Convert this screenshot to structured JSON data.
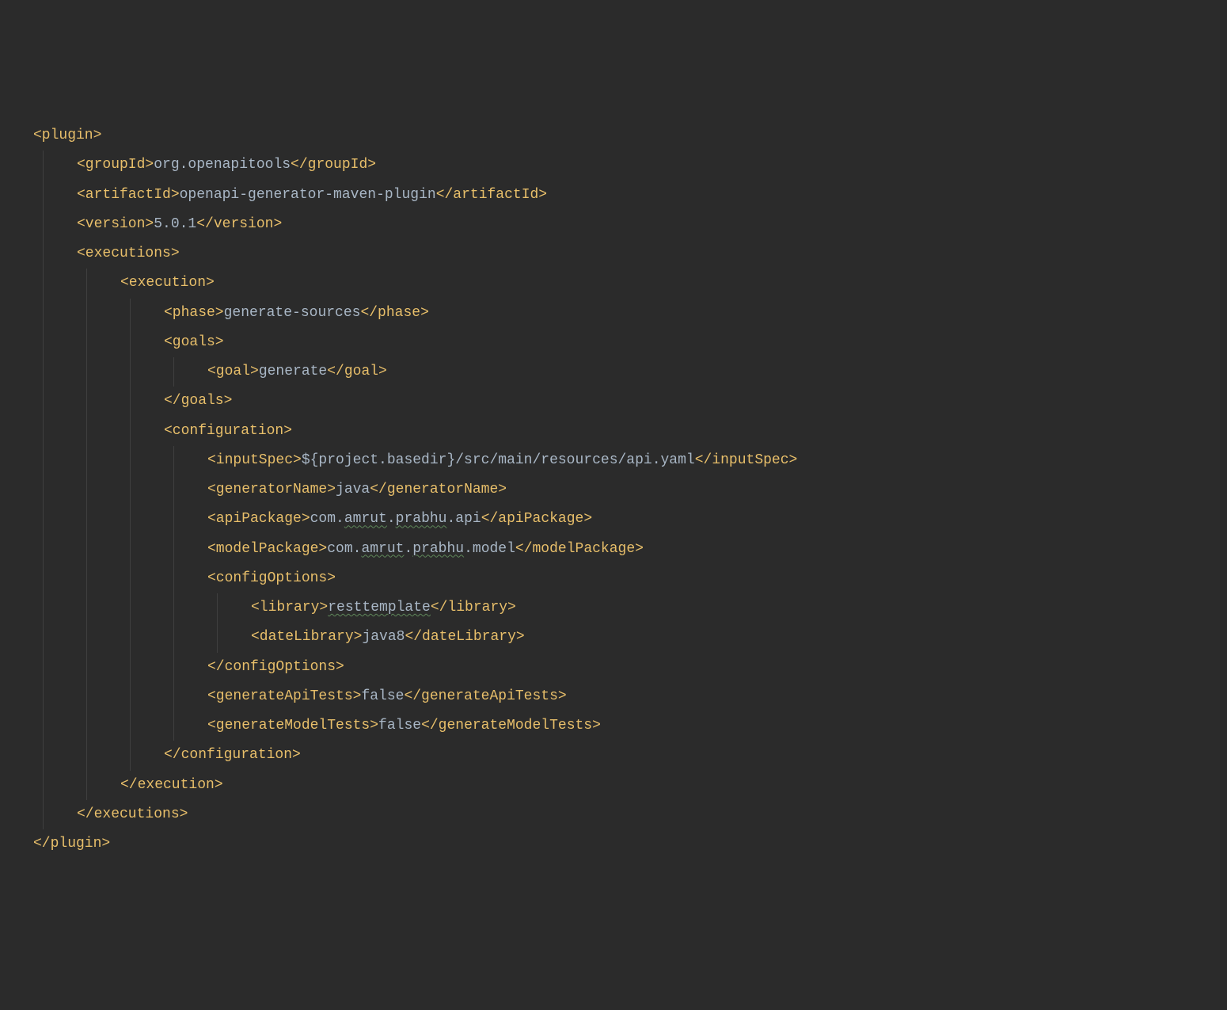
{
  "code": {
    "lines": [
      {
        "indent": 0,
        "guides": [],
        "segments": [
          {
            "type": "tag",
            "text": "<plugin>"
          }
        ]
      },
      {
        "indent": 1,
        "guides": [
          0
        ],
        "segments": [
          {
            "type": "tag",
            "text": "<groupId>"
          },
          {
            "type": "text",
            "text": "org.openapitools"
          },
          {
            "type": "tag",
            "text": "</groupId>"
          }
        ]
      },
      {
        "indent": 1,
        "guides": [
          0
        ],
        "segments": [
          {
            "type": "tag",
            "text": "<artifactId>"
          },
          {
            "type": "text",
            "text": "openapi-generator-maven-plugin"
          },
          {
            "type": "tag",
            "text": "</artifactId>"
          }
        ]
      },
      {
        "indent": 1,
        "guides": [
          0
        ],
        "segments": [
          {
            "type": "tag",
            "text": "<version>"
          },
          {
            "type": "text",
            "text": "5.0.1"
          },
          {
            "type": "tag",
            "text": "</version>"
          }
        ]
      },
      {
        "indent": 1,
        "guides": [
          0
        ],
        "segments": [
          {
            "type": "tag",
            "text": "<executions>"
          }
        ]
      },
      {
        "indent": 2,
        "guides": [
          0,
          1
        ],
        "segments": [
          {
            "type": "tag",
            "text": "<execution>"
          }
        ]
      },
      {
        "indent": 3,
        "guides": [
          0,
          1,
          2
        ],
        "segments": [
          {
            "type": "tag",
            "text": "<phase>"
          },
          {
            "type": "text",
            "text": "generate-sources"
          },
          {
            "type": "tag",
            "text": "</phase>"
          }
        ]
      },
      {
        "indent": 3,
        "guides": [
          0,
          1,
          2
        ],
        "segments": [
          {
            "type": "tag",
            "text": "<goals>"
          }
        ]
      },
      {
        "indent": 4,
        "guides": [
          0,
          1,
          2,
          3
        ],
        "segments": [
          {
            "type": "tag",
            "text": "<goal>"
          },
          {
            "type": "text",
            "text": "generate"
          },
          {
            "type": "tag",
            "text": "</goal>"
          }
        ]
      },
      {
        "indent": 3,
        "guides": [
          0,
          1,
          2
        ],
        "segments": [
          {
            "type": "tag",
            "text": "</goals>"
          }
        ]
      },
      {
        "indent": 3,
        "guides": [
          0,
          1,
          2
        ],
        "segments": [
          {
            "type": "tag",
            "text": "<configuration>"
          }
        ]
      },
      {
        "indent": 4,
        "guides": [
          0,
          1,
          2,
          3
        ],
        "segments": [
          {
            "type": "tag",
            "text": "<inputSpec>"
          },
          {
            "type": "text",
            "text": "${project.basedir}/src/main/resources/api.yaml"
          },
          {
            "type": "tag",
            "text": "</inputSpec>"
          }
        ]
      },
      {
        "indent": 4,
        "guides": [
          0,
          1,
          2,
          3
        ],
        "segments": [
          {
            "type": "tag",
            "text": "<generatorName>"
          },
          {
            "type": "text",
            "text": "java"
          },
          {
            "type": "tag",
            "text": "</generatorName>"
          }
        ]
      },
      {
        "indent": 4,
        "guides": [
          0,
          1,
          2,
          3
        ],
        "segments": [
          {
            "type": "tag",
            "text": "<apiPackage>"
          },
          {
            "type": "text",
            "text": "com."
          },
          {
            "type": "wavy",
            "text": "amrut"
          },
          {
            "type": "text",
            "text": "."
          },
          {
            "type": "wavy",
            "text": "prabhu"
          },
          {
            "type": "text",
            "text": ".api"
          },
          {
            "type": "tag",
            "text": "</apiPackage>"
          }
        ]
      },
      {
        "indent": 4,
        "guides": [
          0,
          1,
          2,
          3
        ],
        "segments": [
          {
            "type": "tag",
            "text": "<modelPackage>"
          },
          {
            "type": "text",
            "text": "com."
          },
          {
            "type": "wavy",
            "text": "amrut"
          },
          {
            "type": "text",
            "text": "."
          },
          {
            "type": "wavy",
            "text": "prabhu"
          },
          {
            "type": "text",
            "text": ".model"
          },
          {
            "type": "tag",
            "text": "</modelPackage>"
          }
        ]
      },
      {
        "indent": 4,
        "guides": [
          0,
          1,
          2,
          3
        ],
        "segments": [
          {
            "type": "tag",
            "text": "<configOptions>"
          }
        ]
      },
      {
        "indent": 5,
        "guides": [
          0,
          1,
          2,
          3,
          4
        ],
        "segments": [
          {
            "type": "tag",
            "text": "<library>"
          },
          {
            "type": "wavy",
            "text": "resttemplate"
          },
          {
            "type": "tag",
            "text": "</library>"
          }
        ]
      },
      {
        "indent": 5,
        "guides": [
          0,
          1,
          2,
          3,
          4
        ],
        "segments": [
          {
            "type": "tag",
            "text": "<dateLibrary>"
          },
          {
            "type": "text",
            "text": "java8"
          },
          {
            "type": "tag",
            "text": "</dateLibrary>"
          }
        ]
      },
      {
        "indent": 4,
        "guides": [
          0,
          1,
          2,
          3
        ],
        "segments": [
          {
            "type": "tag",
            "text": "</configOptions>"
          }
        ]
      },
      {
        "indent": 4,
        "guides": [
          0,
          1,
          2,
          3
        ],
        "segments": [
          {
            "type": "tag",
            "text": "<generateApiTests>"
          },
          {
            "type": "text",
            "text": "false"
          },
          {
            "type": "tag",
            "text": "</generateApiTests>"
          }
        ]
      },
      {
        "indent": 4,
        "guides": [
          0,
          1,
          2,
          3
        ],
        "segments": [
          {
            "type": "tag",
            "text": "<generateModelTests>"
          },
          {
            "type": "text",
            "text": "false"
          },
          {
            "type": "tag",
            "text": "</generateModelTests>"
          }
        ]
      },
      {
        "indent": 3,
        "guides": [
          0,
          1,
          2
        ],
        "segments": [
          {
            "type": "tag",
            "text": "</configuration>"
          }
        ]
      },
      {
        "indent": 2,
        "guides": [
          0,
          1
        ],
        "segments": [
          {
            "type": "tag",
            "text": "</execution>"
          }
        ]
      },
      {
        "indent": 1,
        "guides": [
          0
        ],
        "segments": [
          {
            "type": "tag",
            "text": "</executions>"
          }
        ]
      },
      {
        "indent": 0,
        "guides": [],
        "segments": [
          {
            "type": "tag",
            "text": "</plugin>"
          }
        ]
      }
    ],
    "indentSize": 55,
    "guideOffset": 12
  }
}
